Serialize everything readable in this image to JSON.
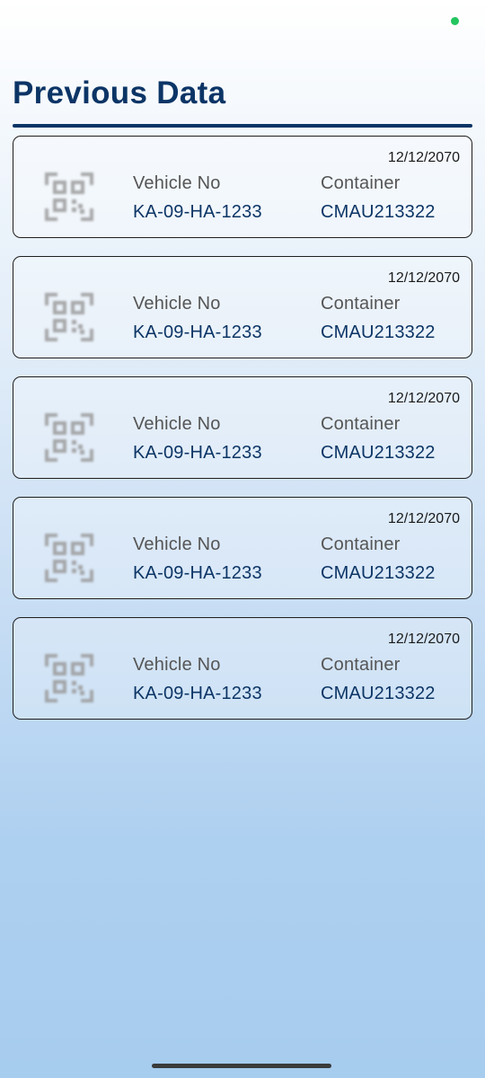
{
  "colors": {
    "title": "#0c3566",
    "accent_rule": "#0c3566",
    "value_text": "#0c3566",
    "status_dot": "#22c55e",
    "home_indicator": "#3a3a3a"
  },
  "status_bar": {
    "indicator_icon": "green-dot-icon"
  },
  "page": {
    "title": "Previous Data"
  },
  "records": [
    {
      "date": "12/12/2070",
      "icon": "qr-code-icon",
      "vehicle_label": "Vehicle No",
      "vehicle_value": "KA-09-HA-1233",
      "container_label": "Container",
      "container_value": "CMAU213322"
    },
    {
      "date": "12/12/2070",
      "icon": "qr-code-icon",
      "vehicle_label": "Vehicle No",
      "vehicle_value": "KA-09-HA-1233",
      "container_label": "Container",
      "container_value": "CMAU213322"
    },
    {
      "date": "12/12/2070",
      "icon": "qr-code-icon",
      "vehicle_label": "Vehicle No",
      "vehicle_value": "KA-09-HA-1233",
      "container_label": "Container",
      "container_value": "CMAU213322"
    },
    {
      "date": "12/12/2070",
      "icon": "qr-code-icon",
      "vehicle_label": "Vehicle No",
      "vehicle_value": "KA-09-HA-1233",
      "container_label": "Container",
      "container_value": "CMAU213322"
    },
    {
      "date": "12/12/2070",
      "icon": "qr-code-icon",
      "vehicle_label": "Vehicle No",
      "vehicle_value": "KA-09-HA-1233",
      "container_label": "Container",
      "container_value": "CMAU213322"
    }
  ]
}
